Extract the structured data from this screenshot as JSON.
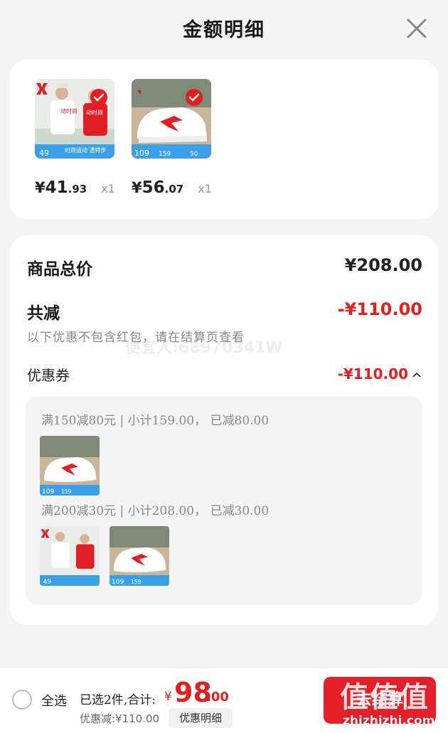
{
  "header": {
    "title": "金额明细"
  },
  "products": [
    {
      "price_symbol": "¥",
      "price_int": "41",
      "price_dec": ".93",
      "qty": "x1",
      "tag_price": "49",
      "tag_text": "时尚运动 透特步",
      "image": "couple-tshirt"
    },
    {
      "price_symbol": "¥",
      "price_int": "56",
      "price_dec": ".07",
      "qty": "x1",
      "tag_price": "109",
      "tag_mid": "159",
      "tag_right": "50",
      "image": "white-sneaker"
    }
  ],
  "summary": {
    "total_label": "商品总价",
    "total_value": "¥208.00",
    "discount_label": "共减",
    "discount_value": "-¥110.00",
    "note": "以下优惠不包含红包，请在结算页查看",
    "coupon_label": "优惠券",
    "coupon_value": "-¥110.00",
    "watermark": "便宜人:68970341W",
    "rules": [
      {
        "text": "满150减80元 | 小计159.00， 已减80.00"
      },
      {
        "text": "满200减30元 | 小计208.00， 已减30.00"
      }
    ]
  },
  "bottom": {
    "select_all": "全选",
    "selected_text": "已选2件,合计:",
    "total_symbol": "¥",
    "total_int": "98",
    "total_dec": ".00",
    "saved": "优惠减:¥110.00",
    "detail_button": "优惠明细",
    "checkout_button": "去结算",
    "brand_watermark": "值值值",
    "brand_url": "zhizhizhi.com"
  },
  "colors": {
    "accent": "#e61d1d",
    "tag_blue": "#3aa0e8"
  }
}
